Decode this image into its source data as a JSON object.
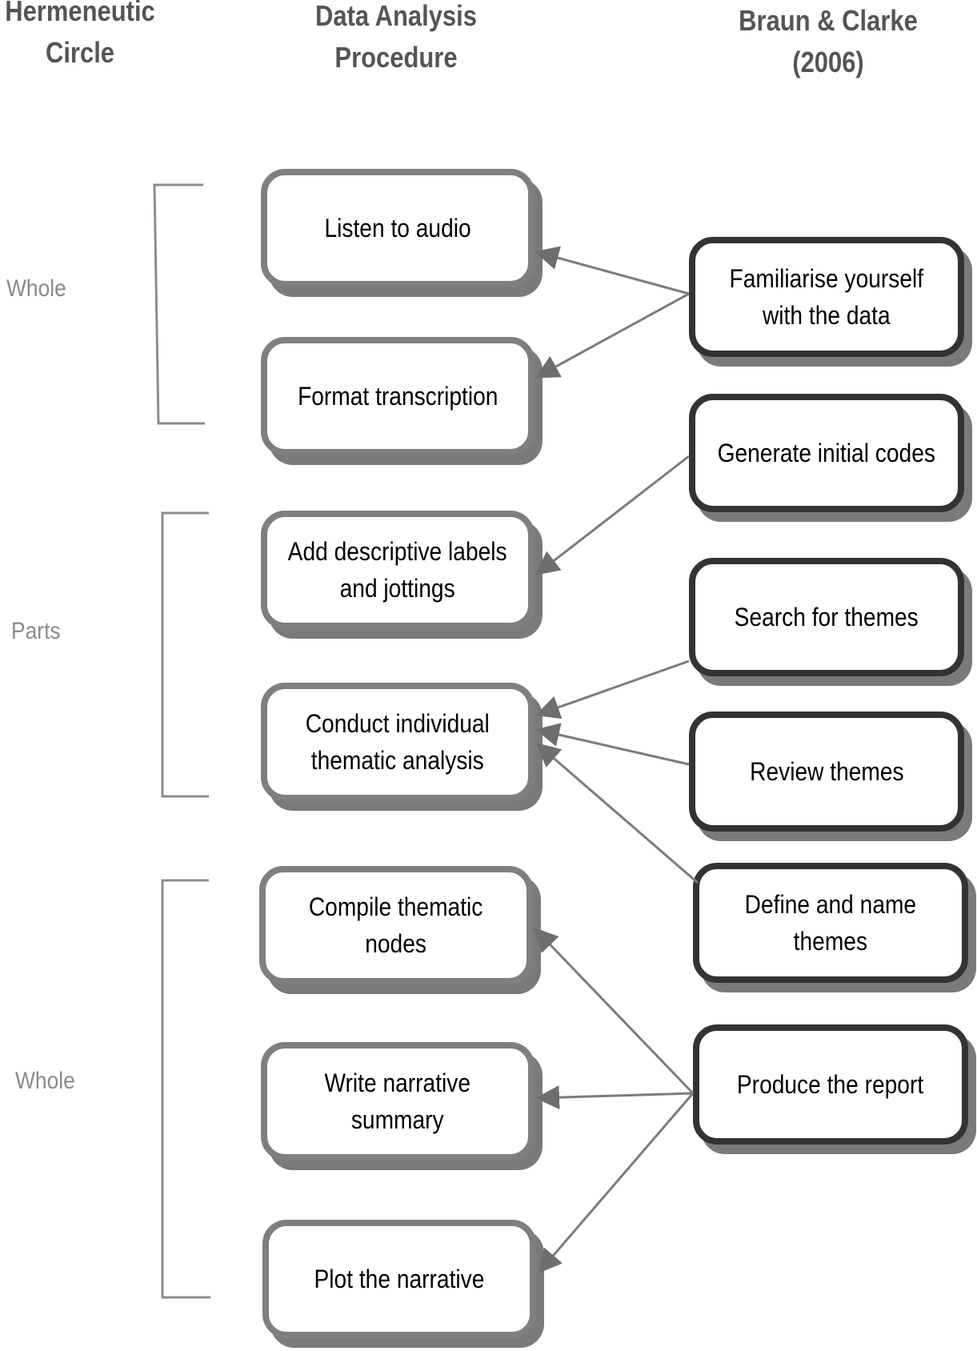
{
  "headers": {
    "hermeneutic": [
      "Hermeneutic",
      "Circle"
    ],
    "procedure": [
      "Data Analysis",
      "Procedure"
    ],
    "braun_clarke": [
      "Braun & Clarke",
      "(2006)"
    ]
  },
  "brackets": [
    {
      "label": "Whole"
    },
    {
      "label": "Parts"
    },
    {
      "label": "Whole"
    }
  ],
  "procedure_steps": [
    {
      "lines": [
        "Listen to audio"
      ]
    },
    {
      "lines": [
        "Format transcription"
      ]
    },
    {
      "lines": [
        "Add descriptive labels",
        "and jottings"
      ]
    },
    {
      "lines": [
        "Conduct individual",
        "thematic analysis"
      ]
    },
    {
      "lines": [
        "Compile thematic",
        "nodes"
      ]
    },
    {
      "lines": [
        "Write narrative",
        "summary"
      ]
    },
    {
      "lines": [
        "Plot the narrative"
      ]
    }
  ],
  "braun_clarke_phases": [
    {
      "lines": [
        "Familiarise yourself",
        "with the data"
      ]
    },
    {
      "lines": [
        "Generate initial codes"
      ]
    },
    {
      "lines": [
        "Search for themes"
      ]
    },
    {
      "lines": [
        "Review themes"
      ]
    },
    {
      "lines": [
        "Define and name",
        "themes"
      ]
    },
    {
      "lines": [
        "Produce the report"
      ]
    }
  ],
  "mappings": [
    {
      "from_phase": 0,
      "to_step": 0
    },
    {
      "from_phase": 0,
      "to_step": 1
    },
    {
      "from_phase": 1,
      "to_step": 2
    },
    {
      "from_phase": 2,
      "to_step": 3
    },
    {
      "from_phase": 3,
      "to_step": 3
    },
    {
      "from_phase": 4,
      "to_step": 3
    },
    {
      "from_phase": 5,
      "to_step": 4
    },
    {
      "from_phase": 5,
      "to_step": 5
    },
    {
      "from_phase": 5,
      "to_step": 6
    }
  ]
}
